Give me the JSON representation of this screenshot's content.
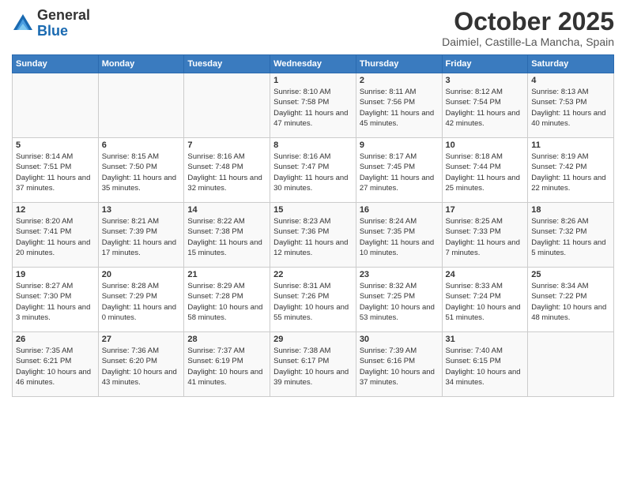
{
  "header": {
    "logo_general": "General",
    "logo_blue": "Blue",
    "month_title": "October 2025",
    "location": "Daimiel, Castille-La Mancha, Spain"
  },
  "days_of_week": [
    "Sunday",
    "Monday",
    "Tuesday",
    "Wednesday",
    "Thursday",
    "Friday",
    "Saturday"
  ],
  "weeks": [
    [
      {
        "day": "",
        "info": ""
      },
      {
        "day": "",
        "info": ""
      },
      {
        "day": "",
        "info": ""
      },
      {
        "day": "1",
        "info": "Sunrise: 8:10 AM\nSunset: 7:58 PM\nDaylight: 11 hours and 47 minutes."
      },
      {
        "day": "2",
        "info": "Sunrise: 8:11 AM\nSunset: 7:56 PM\nDaylight: 11 hours and 45 minutes."
      },
      {
        "day": "3",
        "info": "Sunrise: 8:12 AM\nSunset: 7:54 PM\nDaylight: 11 hours and 42 minutes."
      },
      {
        "day": "4",
        "info": "Sunrise: 8:13 AM\nSunset: 7:53 PM\nDaylight: 11 hours and 40 minutes."
      }
    ],
    [
      {
        "day": "5",
        "info": "Sunrise: 8:14 AM\nSunset: 7:51 PM\nDaylight: 11 hours and 37 minutes."
      },
      {
        "day": "6",
        "info": "Sunrise: 8:15 AM\nSunset: 7:50 PM\nDaylight: 11 hours and 35 minutes."
      },
      {
        "day": "7",
        "info": "Sunrise: 8:16 AM\nSunset: 7:48 PM\nDaylight: 11 hours and 32 minutes."
      },
      {
        "day": "8",
        "info": "Sunrise: 8:16 AM\nSunset: 7:47 PM\nDaylight: 11 hours and 30 minutes."
      },
      {
        "day": "9",
        "info": "Sunrise: 8:17 AM\nSunset: 7:45 PM\nDaylight: 11 hours and 27 minutes."
      },
      {
        "day": "10",
        "info": "Sunrise: 8:18 AM\nSunset: 7:44 PM\nDaylight: 11 hours and 25 minutes."
      },
      {
        "day": "11",
        "info": "Sunrise: 8:19 AM\nSunset: 7:42 PM\nDaylight: 11 hours and 22 minutes."
      }
    ],
    [
      {
        "day": "12",
        "info": "Sunrise: 8:20 AM\nSunset: 7:41 PM\nDaylight: 11 hours and 20 minutes."
      },
      {
        "day": "13",
        "info": "Sunrise: 8:21 AM\nSunset: 7:39 PM\nDaylight: 11 hours and 17 minutes."
      },
      {
        "day": "14",
        "info": "Sunrise: 8:22 AM\nSunset: 7:38 PM\nDaylight: 11 hours and 15 minutes."
      },
      {
        "day": "15",
        "info": "Sunrise: 8:23 AM\nSunset: 7:36 PM\nDaylight: 11 hours and 12 minutes."
      },
      {
        "day": "16",
        "info": "Sunrise: 8:24 AM\nSunset: 7:35 PM\nDaylight: 11 hours and 10 minutes."
      },
      {
        "day": "17",
        "info": "Sunrise: 8:25 AM\nSunset: 7:33 PM\nDaylight: 11 hours and 7 minutes."
      },
      {
        "day": "18",
        "info": "Sunrise: 8:26 AM\nSunset: 7:32 PM\nDaylight: 11 hours and 5 minutes."
      }
    ],
    [
      {
        "day": "19",
        "info": "Sunrise: 8:27 AM\nSunset: 7:30 PM\nDaylight: 11 hours and 3 minutes."
      },
      {
        "day": "20",
        "info": "Sunrise: 8:28 AM\nSunset: 7:29 PM\nDaylight: 11 hours and 0 minutes."
      },
      {
        "day": "21",
        "info": "Sunrise: 8:29 AM\nSunset: 7:28 PM\nDaylight: 10 hours and 58 minutes."
      },
      {
        "day": "22",
        "info": "Sunrise: 8:31 AM\nSunset: 7:26 PM\nDaylight: 10 hours and 55 minutes."
      },
      {
        "day": "23",
        "info": "Sunrise: 8:32 AM\nSunset: 7:25 PM\nDaylight: 10 hours and 53 minutes."
      },
      {
        "day": "24",
        "info": "Sunrise: 8:33 AM\nSunset: 7:24 PM\nDaylight: 10 hours and 51 minutes."
      },
      {
        "day": "25",
        "info": "Sunrise: 8:34 AM\nSunset: 7:22 PM\nDaylight: 10 hours and 48 minutes."
      }
    ],
    [
      {
        "day": "26",
        "info": "Sunrise: 7:35 AM\nSunset: 6:21 PM\nDaylight: 10 hours and 46 minutes."
      },
      {
        "day": "27",
        "info": "Sunrise: 7:36 AM\nSunset: 6:20 PM\nDaylight: 10 hours and 43 minutes."
      },
      {
        "day": "28",
        "info": "Sunrise: 7:37 AM\nSunset: 6:19 PM\nDaylight: 10 hours and 41 minutes."
      },
      {
        "day": "29",
        "info": "Sunrise: 7:38 AM\nSunset: 6:17 PM\nDaylight: 10 hours and 39 minutes."
      },
      {
        "day": "30",
        "info": "Sunrise: 7:39 AM\nSunset: 6:16 PM\nDaylight: 10 hours and 37 minutes."
      },
      {
        "day": "31",
        "info": "Sunrise: 7:40 AM\nSunset: 6:15 PM\nDaylight: 10 hours and 34 minutes."
      },
      {
        "day": "",
        "info": ""
      }
    ]
  ]
}
